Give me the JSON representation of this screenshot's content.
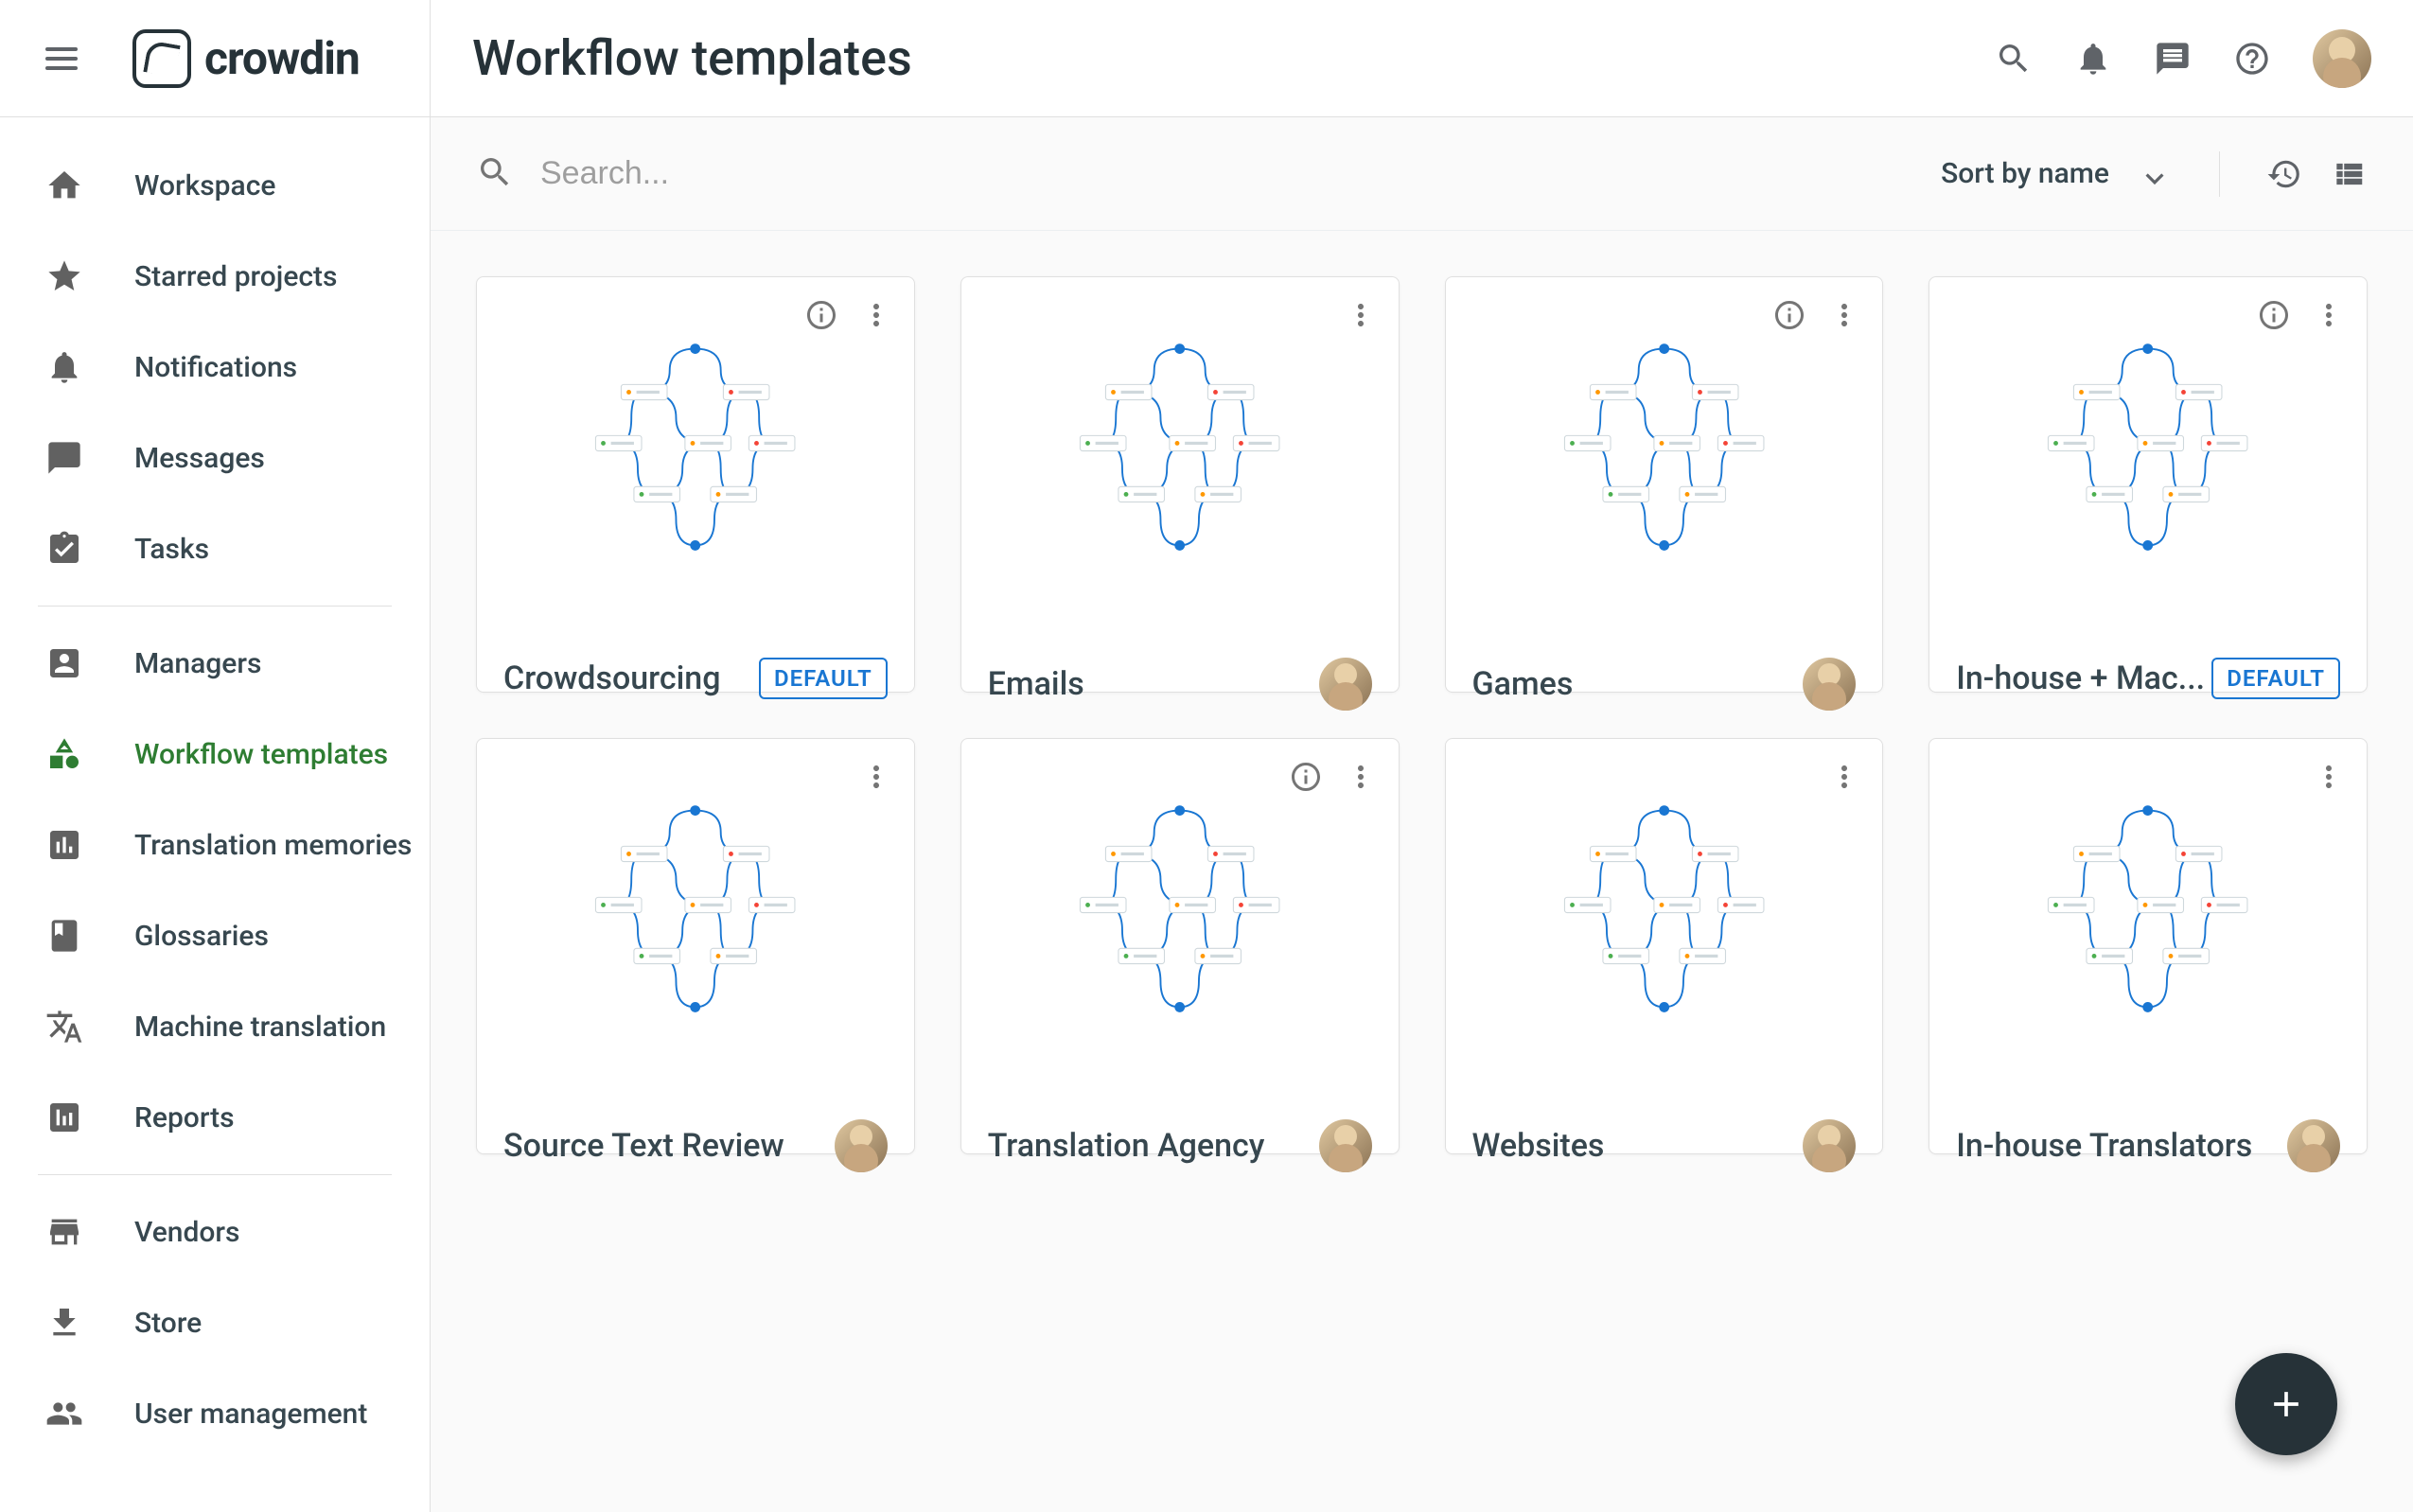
{
  "brand": "crowdin",
  "header": {
    "title": "Workflow templates"
  },
  "sidebar": {
    "items": [
      {
        "label": "Workspace",
        "icon": "home"
      },
      {
        "label": "Starred projects",
        "icon": "star"
      },
      {
        "label": "Notifications",
        "icon": "bell"
      },
      {
        "label": "Messages",
        "icon": "chat"
      },
      {
        "label": "Tasks",
        "icon": "task"
      }
    ],
    "items2": [
      {
        "label": "Managers",
        "icon": "manager"
      },
      {
        "label": "Workflow templates",
        "icon": "workflow",
        "active": true
      },
      {
        "label": "Translation memories",
        "icon": "tm"
      },
      {
        "label": "Glossaries",
        "icon": "glossary"
      },
      {
        "label": "Machine translation",
        "icon": "mt"
      },
      {
        "label": "Reports",
        "icon": "reports"
      }
    ],
    "items3": [
      {
        "label": "Vendors",
        "icon": "vendors"
      },
      {
        "label": "Store",
        "icon": "store"
      },
      {
        "label": "User management",
        "icon": "users"
      }
    ]
  },
  "toolbar": {
    "search_placeholder": "Search...",
    "sort_label": "Sort by name"
  },
  "cards": [
    {
      "title": "Crowdsourcing",
      "info": true,
      "default": true,
      "avatar": false
    },
    {
      "title": "Emails",
      "info": false,
      "default": false,
      "avatar": true
    },
    {
      "title": "Games",
      "info": true,
      "default": false,
      "avatar": true
    },
    {
      "title": "In-house + Mac...",
      "info": true,
      "default": true,
      "avatar": false
    },
    {
      "title": "Source Text Review",
      "info": false,
      "default": false,
      "avatar": true
    },
    {
      "title": "Translation Agency",
      "info": true,
      "default": false,
      "avatar": true
    },
    {
      "title": "Websites",
      "info": false,
      "default": false,
      "avatar": true
    },
    {
      "title": "In-house Translators",
      "info": false,
      "default": false,
      "avatar": true
    }
  ],
  "badge_default": "DEFAULT"
}
